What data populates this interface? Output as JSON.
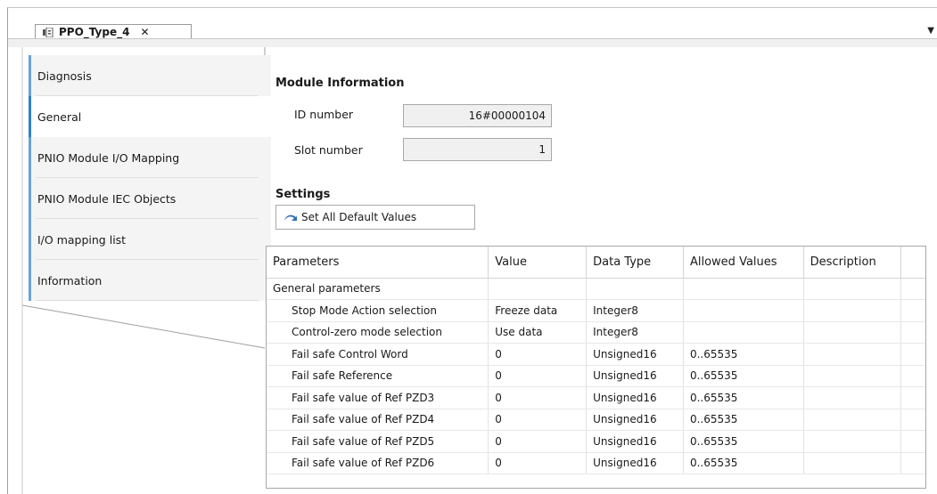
{
  "tab": {
    "title": "PPO_Type_4",
    "close_glyph": "✕",
    "dropdown_glyph": "▼"
  },
  "sidebar": {
    "items": [
      {
        "label": "Diagnosis"
      },
      {
        "label": "General"
      },
      {
        "label": "PNIO Module I/O Mapping"
      },
      {
        "label": "PNIO Module IEC Objects"
      },
      {
        "label": "I/O mapping list"
      },
      {
        "label": "Information"
      }
    ]
  },
  "module_info": {
    "title": "Module Information",
    "id_label": "ID number",
    "id_value": "16#00000104",
    "slot_label": "Slot number",
    "slot_value": "1"
  },
  "settings": {
    "title": "Settings",
    "default_button": "Set All Default Values"
  },
  "table": {
    "headers": [
      "Parameters",
      "Value",
      "Data Type",
      "Allowed Values",
      "Description"
    ],
    "group": "General parameters",
    "rows": [
      {
        "param": "Stop Mode Action selection",
        "value": "Freeze data",
        "type": "Integer8",
        "allowed": "",
        "desc": ""
      },
      {
        "param": "Control-zero mode selection",
        "value": "Use data",
        "type": "Integer8",
        "allowed": "",
        "desc": ""
      },
      {
        "param": "Fail safe Control Word",
        "value": "0",
        "type": "Unsigned16",
        "allowed": "0..65535",
        "desc": ""
      },
      {
        "param": "Fail safe Reference",
        "value": "0",
        "type": "Unsigned16",
        "allowed": "0..65535",
        "desc": ""
      },
      {
        "param": "Fail safe value of Ref PZD3",
        "value": "0",
        "type": "Unsigned16",
        "allowed": "0..65535",
        "desc": ""
      },
      {
        "param": "Fail safe value of Ref PZD4",
        "value": "0",
        "type": "Unsigned16",
        "allowed": "0..65535",
        "desc": ""
      },
      {
        "param": "Fail safe value of Ref PZD5",
        "value": "0",
        "type": "Unsigned16",
        "allowed": "0..65535",
        "desc": ""
      },
      {
        "param": "Fail safe value of Ref PZD6",
        "value": "0",
        "type": "Unsigned16",
        "allowed": "0..65535",
        "desc": ""
      }
    ]
  },
  "colors": {
    "accent": "#2e7fd0",
    "accent_light": "#6aa2d8"
  }
}
